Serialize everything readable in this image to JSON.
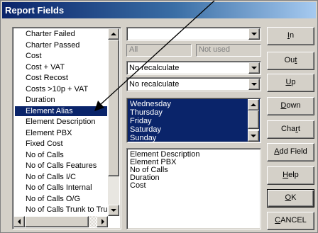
{
  "window": {
    "title": "Report Fields"
  },
  "field_list": {
    "items": [
      "Charter Failed",
      "Charter Passed",
      "Cost",
      "Cost + VAT",
      "Cost Recost",
      "Costs >10p + VAT",
      "Duration",
      "Element Alias",
      "Element Description",
      "Element PBX",
      "Fixed Cost",
      "No of Calls",
      "No of Calls Features",
      "No of Calls I/C",
      "No of Calls Internal",
      "No of Calls O/G",
      "No of Calls Trunk to Tru"
    ],
    "selected": "Element Alias"
  },
  "combo_top": {
    "value": ""
  },
  "range": {
    "from_placeholder": "All",
    "to_placeholder": "Not used"
  },
  "recalc_1": {
    "value": "No recalculate"
  },
  "recalc_2": {
    "value": "No recalculate"
  },
  "days": [
    "Wednesday",
    "Thursday",
    "Friday",
    "Saturday",
    "Sunday"
  ],
  "selected_fields": [
    "Element Description",
    "Element PBX",
    "No of Calls",
    "Duration",
    "Cost"
  ],
  "buttons": {
    "in": {
      "label": "In",
      "mnemonic": "I"
    },
    "out": {
      "label": "Out",
      "mnemonic": "t"
    },
    "up": {
      "label": "Up",
      "mnemonic": "U"
    },
    "down": {
      "label": "Down",
      "mnemonic": "D"
    },
    "chart": {
      "label": "Chart",
      "mnemonic": "r"
    },
    "add_field": {
      "label": "Add Field",
      "mnemonic": "A"
    },
    "help": {
      "label": "Help",
      "mnemonic": "H"
    },
    "ok": {
      "label": "OK",
      "mnemonic": "O"
    },
    "cancel": {
      "label": "CANCEL",
      "mnemonic": "C"
    }
  }
}
